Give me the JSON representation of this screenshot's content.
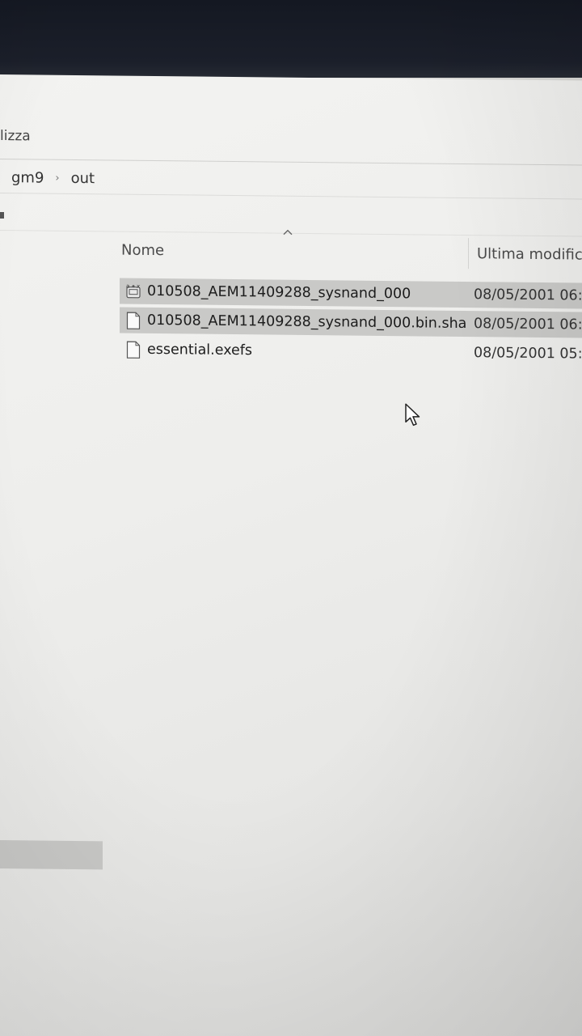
{
  "ribbon": {
    "visible_tab_fragment": "lizza"
  },
  "address_bar": {
    "crumbs": [
      "gm9",
      "out"
    ],
    "separator": "›"
  },
  "columns": {
    "name": "Nome",
    "date": "Ultima modific"
  },
  "files": [
    {
      "name": "010508_AEM11409288_sysnand_000",
      "date": "08/05/2001 06:",
      "icon": "unknown-file-type-icon",
      "selected": true
    },
    {
      "name": "010508_AEM11409288_sysnand_000.bin.sha",
      "date": "08/05/2001 06:2",
      "icon": "blank-file-icon",
      "selected": true
    },
    {
      "name": "essential.exefs",
      "date": "08/05/2001 05:5",
      "icon": "blank-file-icon",
      "selected": false
    }
  ],
  "colors": {
    "selection": "#c9c9c7",
    "background": "#eeeeec",
    "bezel": "#1b1f2a"
  }
}
